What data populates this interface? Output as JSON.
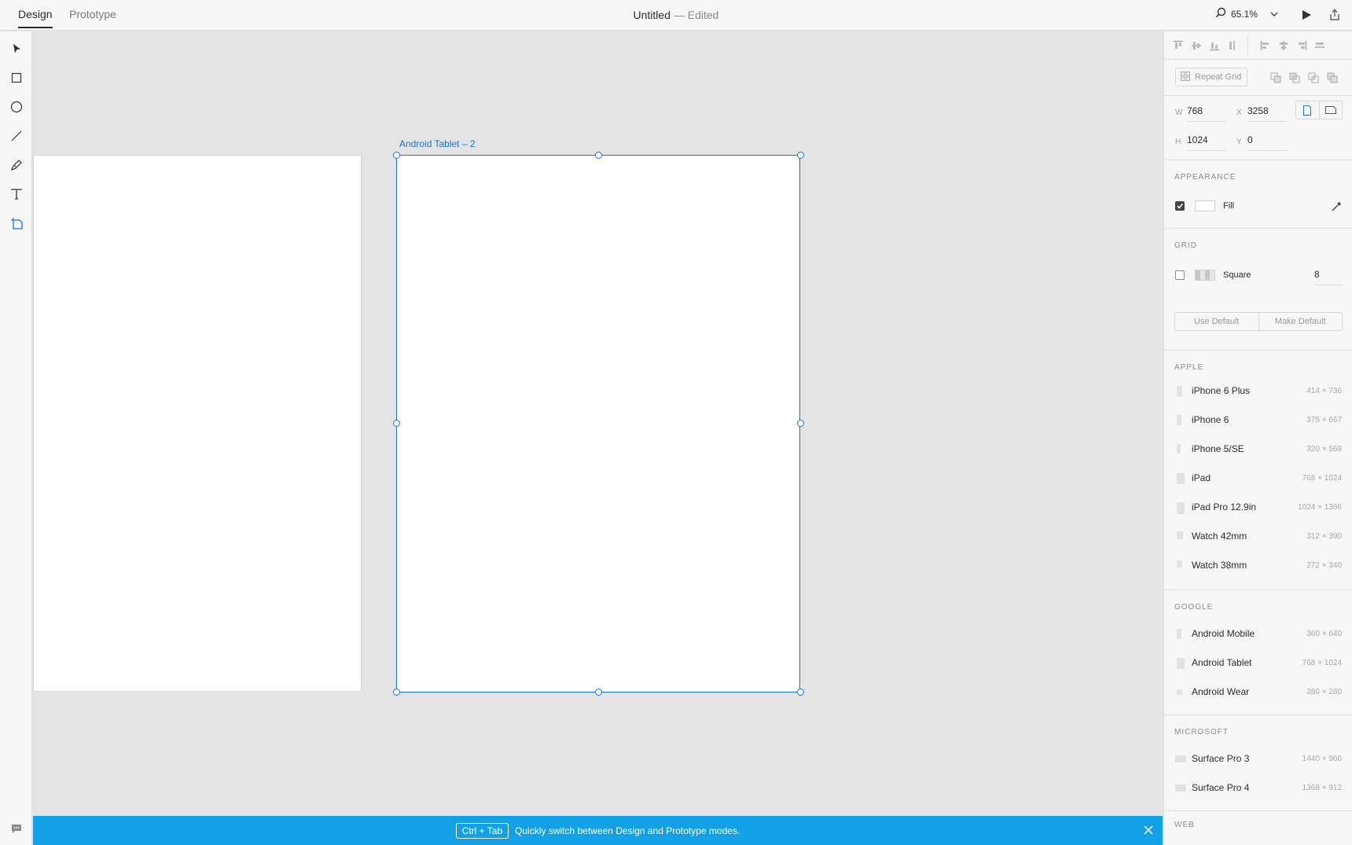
{
  "tabs": [
    {
      "label": "Design",
      "active": true
    },
    {
      "label": "Prototype",
      "active": false
    }
  ],
  "document": {
    "name": "Untitled",
    "separator": " — ",
    "status": "Edited"
  },
  "zoom": "65.1%",
  "tools": [
    "select-tool",
    "rectangle-tool",
    "ellipse-tool",
    "line-tool",
    "pen-tool",
    "text-tool",
    "artboard-tool"
  ],
  "canvas": {
    "left_artboard_label": "|",
    "selected_artboard_label": "Android Tablet – 2"
  },
  "banner": {
    "shortcut": "Ctrl + Tab",
    "message": "Quickly switch between Design and Prototype modes."
  },
  "panel": {
    "repeat_grid_label": "Repeat Grid",
    "w_label": "W",
    "w_value": "768",
    "x_label": "X",
    "x_value": "3258",
    "h_label": "H",
    "h_value": "1024",
    "y_label": "Y",
    "y_value": "0",
    "appearance_title": "APPEARANCE",
    "fill_label": "Fill",
    "fill_checked": true,
    "fill_color": "#ffffff",
    "grid_title": "GRID",
    "grid_type": "Square",
    "grid_size": "8",
    "grid_checked": false,
    "use_default_label": "Use Default",
    "make_default_label": "Make Default",
    "apple_title": "APPLE",
    "apple_presets": [
      {
        "name": "iPhone 6 Plus",
        "size": "414 × 736"
      },
      {
        "name": "iPhone 6",
        "size": "375 × 667"
      },
      {
        "name": "iPhone 5/SE",
        "size": "320 × 568"
      },
      {
        "name": "iPad",
        "size": "768 × 1024"
      },
      {
        "name": "iPad Pro 12.9in",
        "size": "1024 × 1366"
      },
      {
        "name": "Watch 42mm",
        "size": "312 × 390"
      },
      {
        "name": "Watch 38mm",
        "size": "272 × 340"
      }
    ],
    "google_title": "GOOGLE",
    "google_presets": [
      {
        "name": "Android Mobile",
        "size": "360 × 640"
      },
      {
        "name": "Android Tablet",
        "size": "768 × 1024"
      },
      {
        "name": "Android Wear",
        "size": "280 × 280"
      }
    ],
    "microsoft_title": "MICROSOFT",
    "microsoft_presets": [
      {
        "name": "Surface Pro 3",
        "size": "1440 × 960"
      },
      {
        "name": "Surface Pro 4",
        "size": "1368 × 912"
      }
    ],
    "web_title": "WEB"
  },
  "colors": {
    "accent": "#1473e6",
    "banner": "#12a1e6"
  }
}
